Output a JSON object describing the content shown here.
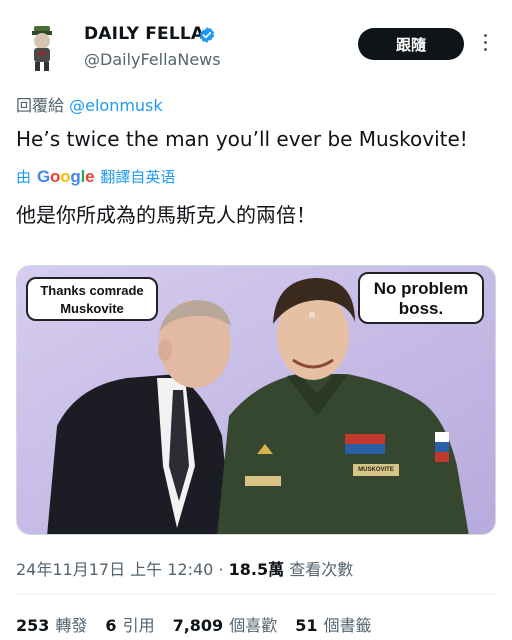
{
  "author": {
    "display_name": "DAILY FELLA",
    "handle": "@DailyFellaNews",
    "verified": true
  },
  "follow_button": {
    "label": "跟隨"
  },
  "reply_to": {
    "prefix": "回覆給",
    "mention": "@elonmusk"
  },
  "tweet": {
    "text": "He’s twice the man you’ll ever be Muskovite!",
    "translation_prefix": "由",
    "translation_provider": "Google",
    "translation_suffix": "翻譯自英语",
    "translated_text": "他是你所成為的馬斯克人的兩倍！"
  },
  "media": {
    "bubble_left": [
      "Thanks comrade",
      "Muskovite"
    ],
    "bubble_right": [
      "No problem",
      "boss."
    ],
    "name_tag": "MUSKOVITE"
  },
  "meta": {
    "timestamp": "24年11月17日 上午 12:40",
    "separator": "·",
    "views_count": "18.5萬",
    "views_label": "查看次數"
  },
  "stats": [
    {
      "count": "253",
      "label": "轉發"
    },
    {
      "count": "6",
      "label": "引用"
    },
    {
      "count": "7,809",
      "label": "個喜歡"
    },
    {
      "count": "51",
      "label": "個書籤"
    }
  ],
  "colors": {
    "accent": "#1d9bf0",
    "secondary_text": "#536471",
    "primary_text": "#0f1419",
    "media_background": "#c9bfe6"
  }
}
